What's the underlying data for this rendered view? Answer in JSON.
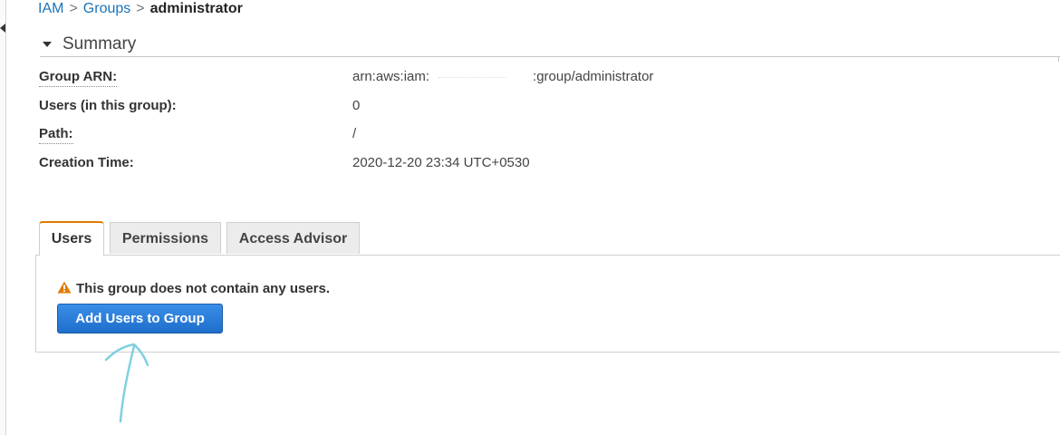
{
  "breadcrumb": {
    "items": [
      "IAM",
      "Groups"
    ],
    "separator": ">",
    "current": "administrator"
  },
  "summary": {
    "title": "Summary",
    "rows": [
      {
        "label": "Group ARN:",
        "value_prefix": "arn:aws:iam:",
        "value_suffix": ":group/administrator"
      },
      {
        "label": "Users (in this group):",
        "value": "0"
      },
      {
        "label": "Path:",
        "value": "/"
      },
      {
        "label": "Creation Time:",
        "value": "2020-12-20 23:34 UTC+0530"
      }
    ]
  },
  "tabs": {
    "items": [
      "Users",
      "Permissions",
      "Access Advisor"
    ],
    "active": "Users"
  },
  "users_panel": {
    "notice": "This group does not contain any users.",
    "add_button_label": "Add Users to Group"
  },
  "colors": {
    "link": "#1a73b8",
    "active_tab_accent": "#e07b00",
    "primary_button": "#1f6fcc",
    "warning_icon": "#e07b00",
    "annotation_arrow": "#7fd0e0"
  },
  "icons": {
    "notice_icon": "warning-icon",
    "collapse_icon": "caret-down-icon",
    "rail_toggle_icon": "caret-left-icon",
    "annotation": "hand-drawn-arrow-icon"
  }
}
